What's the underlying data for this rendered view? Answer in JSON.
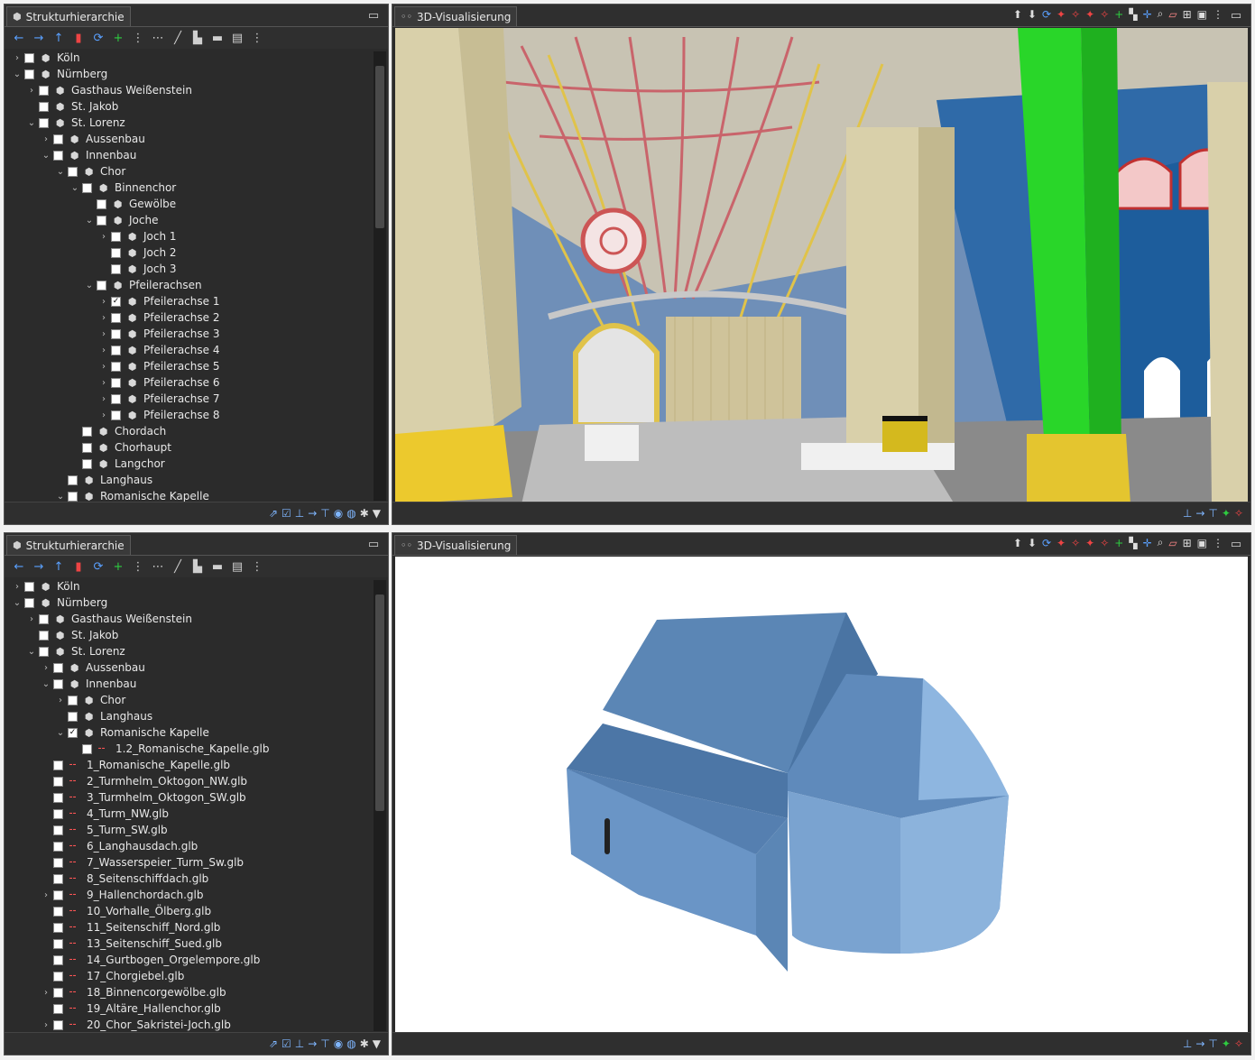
{
  "top_tree_panel": {
    "tab_title": "Strukturhierarchie",
    "items": [
      {
        "label": "Köln",
        "depth": 0,
        "chev": "›",
        "checked": false
      },
      {
        "label": "Nürnberg",
        "depth": 0,
        "chev": "⌄",
        "checked": false
      },
      {
        "label": "Gasthaus Weißenstein",
        "depth": 1,
        "chev": "›",
        "checked": false
      },
      {
        "label": "St. Jakob",
        "depth": 1,
        "chev": "",
        "checked": false
      },
      {
        "label": "St. Lorenz",
        "depth": 1,
        "chev": "⌄",
        "checked": false
      },
      {
        "label": "Aussenbau",
        "depth": 2,
        "chev": "›",
        "checked": false
      },
      {
        "label": "Innenbau",
        "depth": 2,
        "chev": "⌄",
        "checked": false
      },
      {
        "label": "Chor",
        "depth": 3,
        "chev": "⌄",
        "checked": false
      },
      {
        "label": "Binnenchor",
        "depth": 4,
        "chev": "⌄",
        "checked": false
      },
      {
        "label": "Gewölbe",
        "depth": 5,
        "chev": "",
        "checked": false
      },
      {
        "label": "Joche",
        "depth": 5,
        "chev": "⌄",
        "checked": false
      },
      {
        "label": "Joch 1",
        "depth": 6,
        "chev": "›",
        "checked": false
      },
      {
        "label": "Joch 2",
        "depth": 6,
        "chev": "",
        "checked": false
      },
      {
        "label": "Joch 3",
        "depth": 6,
        "chev": "",
        "checked": false
      },
      {
        "label": "Pfeilerachsen",
        "depth": 5,
        "chev": "⌄",
        "checked": false
      },
      {
        "label": "Pfeilerachse 1",
        "depth": 6,
        "chev": "›",
        "checked": true
      },
      {
        "label": "Pfeilerachse 2",
        "depth": 6,
        "chev": "›",
        "checked": false
      },
      {
        "label": "Pfeilerachse 3",
        "depth": 6,
        "chev": "›",
        "checked": false
      },
      {
        "label": "Pfeilerachse 4",
        "depth": 6,
        "chev": "›",
        "checked": false
      },
      {
        "label": "Pfeilerachse 5",
        "depth": 6,
        "chev": "›",
        "checked": false
      },
      {
        "label": "Pfeilerachse 6",
        "depth": 6,
        "chev": "›",
        "checked": false
      },
      {
        "label": "Pfeilerachse 7",
        "depth": 6,
        "chev": "›",
        "checked": false
      },
      {
        "label": "Pfeilerachse 8",
        "depth": 6,
        "chev": "›",
        "checked": false
      },
      {
        "label": "Chordach",
        "depth": 4,
        "chev": "",
        "checked": false
      },
      {
        "label": "Chorhaupt",
        "depth": 4,
        "chev": "",
        "checked": false
      },
      {
        "label": "Langchor",
        "depth": 4,
        "chev": "",
        "checked": false
      },
      {
        "label": "Langhaus",
        "depth": 3,
        "chev": "",
        "checked": false
      },
      {
        "label": "Romanische Kapelle",
        "depth": 3,
        "chev": "⌄",
        "checked": false
      }
    ]
  },
  "bottom_tree_panel": {
    "tab_title": "Strukturhierarchie",
    "items": [
      {
        "label": "Köln",
        "depth": 0,
        "chev": "›",
        "checked": false,
        "kind": "node"
      },
      {
        "label": "Nürnberg",
        "depth": 0,
        "chev": "⌄",
        "checked": false,
        "kind": "node"
      },
      {
        "label": "Gasthaus Weißenstein",
        "depth": 1,
        "chev": "›",
        "checked": false,
        "kind": "node"
      },
      {
        "label": "St. Jakob",
        "depth": 1,
        "chev": "",
        "checked": false,
        "kind": "node"
      },
      {
        "label": "St. Lorenz",
        "depth": 1,
        "chev": "⌄",
        "checked": false,
        "kind": "node"
      },
      {
        "label": "Aussenbau",
        "depth": 2,
        "chev": "›",
        "checked": false,
        "kind": "node"
      },
      {
        "label": "Innenbau",
        "depth": 2,
        "chev": "⌄",
        "checked": false,
        "kind": "node"
      },
      {
        "label": "Chor",
        "depth": 3,
        "chev": "›",
        "checked": false,
        "kind": "node"
      },
      {
        "label": "Langhaus",
        "depth": 3,
        "chev": "",
        "checked": false,
        "kind": "node"
      },
      {
        "label": "Romanische Kapelle",
        "depth": 3,
        "chev": "⌄",
        "checked": true,
        "kind": "node"
      },
      {
        "label": "1.2_Romanische_Kapelle.glb",
        "depth": 4,
        "chev": "",
        "checked": false,
        "kind": "glb"
      },
      {
        "label": "1_Romanische_Kapelle.glb",
        "depth": 2,
        "chev": "",
        "checked": false,
        "kind": "glb"
      },
      {
        "label": "2_Turmhelm_Oktogon_NW.glb",
        "depth": 2,
        "chev": "",
        "checked": false,
        "kind": "glb"
      },
      {
        "label": "3_Turmhelm_Oktogon_SW.glb",
        "depth": 2,
        "chev": "",
        "checked": false,
        "kind": "glb"
      },
      {
        "label": "4_Turm_NW.glb",
        "depth": 2,
        "chev": "",
        "checked": false,
        "kind": "glb"
      },
      {
        "label": "5_Turm_SW.glb",
        "depth": 2,
        "chev": "",
        "checked": false,
        "kind": "glb"
      },
      {
        "label": "6_Langhausdach.glb",
        "depth": 2,
        "chev": "",
        "checked": false,
        "kind": "glb"
      },
      {
        "label": "7_Wasserspeier_Turm_Sw.glb",
        "depth": 2,
        "chev": "",
        "checked": false,
        "kind": "glb"
      },
      {
        "label": "8_Seitenschiffdach.glb",
        "depth": 2,
        "chev": "",
        "checked": false,
        "kind": "glb"
      },
      {
        "label": "9_Hallenchordach.glb",
        "depth": 2,
        "chev": "›",
        "checked": false,
        "kind": "glb"
      },
      {
        "label": "10_Vorhalle_Ölberg.glb",
        "depth": 2,
        "chev": "",
        "checked": false,
        "kind": "glb"
      },
      {
        "label": "11_Seitenschiff_Nord.glb",
        "depth": 2,
        "chev": "",
        "checked": false,
        "kind": "glb"
      },
      {
        "label": "13_Seitenschiff_Sued.glb",
        "depth": 2,
        "chev": "",
        "checked": false,
        "kind": "glb"
      },
      {
        "label": "14_Gurtbogen_Orgelempore.glb",
        "depth": 2,
        "chev": "",
        "checked": false,
        "kind": "glb"
      },
      {
        "label": "17_Chorgiebel.glb",
        "depth": 2,
        "chev": "",
        "checked": false,
        "kind": "glb"
      },
      {
        "label": "18_Binnencorgewölbe.glb",
        "depth": 2,
        "chev": "›",
        "checked": false,
        "kind": "glb"
      },
      {
        "label": "19_Altäre_Hallenchor.glb",
        "depth": 2,
        "chev": "",
        "checked": false,
        "kind": "glb"
      },
      {
        "label": "20_Chor_Sakristei-Joch.glb",
        "depth": 2,
        "chev": "›",
        "checked": false,
        "kind": "glb"
      }
    ]
  },
  "top_viewer": {
    "tab_title": "3D-Visualisierung"
  },
  "bottom_viewer": {
    "tab_title": "3D-Visualisierung"
  },
  "colors": {
    "panel_bg": "#2b2b2b",
    "accent_blue": "#2b6fd6",
    "model_blue": "#6a95c6",
    "vault_blue": "#2d5f96",
    "pillar_beige": "#d9d0aa",
    "green": "#29d629"
  }
}
